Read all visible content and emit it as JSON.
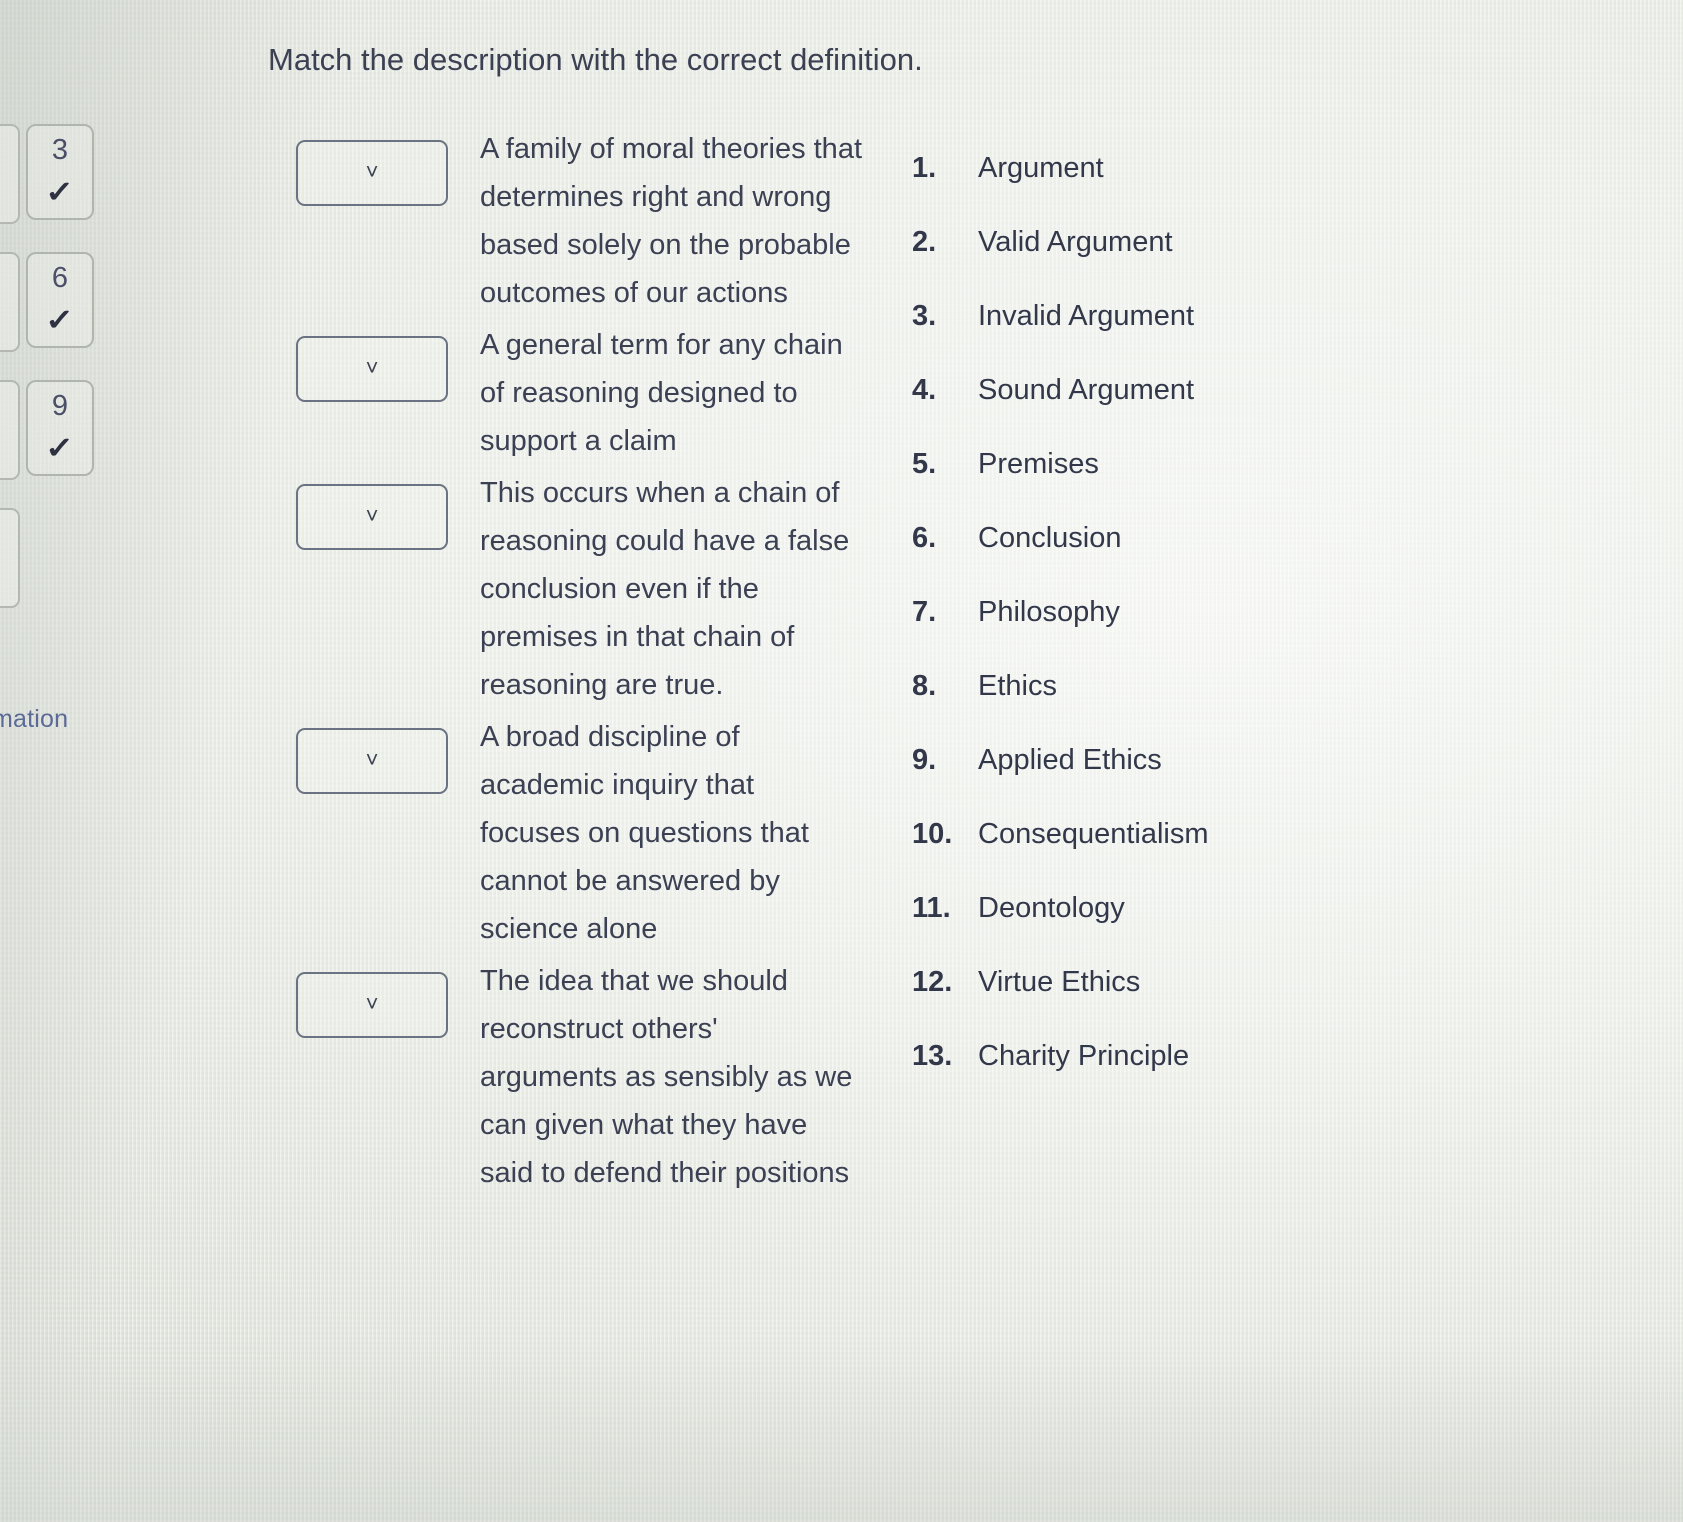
{
  "prompt": "Match the description with the correct definition.",
  "sidebar": {
    "partial_label": "mation",
    "check_glyph": "✓",
    "cards": [
      {
        "number": "3",
        "status": "answered"
      },
      {
        "number": "6",
        "status": "answered"
      },
      {
        "number": "9",
        "status": "answered"
      }
    ]
  },
  "match_rows": [
    {
      "dropdown_value": "",
      "dropdown_icon": "chevron-down-icon",
      "chevron": "˅",
      "description": "A family of moral theories that determines right and wrong based solely on the probable outcomes of our actions"
    },
    {
      "dropdown_value": "",
      "dropdown_icon": "chevron-down-icon",
      "chevron": "˅",
      "description": "A general term for any chain of reasoning designed to support a claim"
    },
    {
      "dropdown_value": "",
      "dropdown_icon": "chevron-down-icon",
      "chevron": "˅",
      "description": "This occurs when a chain of reasoning could have a false conclusion even if the premises in that chain of reasoning are true."
    },
    {
      "dropdown_value": "",
      "dropdown_icon": "chevron-down-icon",
      "chevron": "˅",
      "description": "A broad discipline of academic inquiry that focuses on questions that cannot be answered by science alone"
    },
    {
      "dropdown_value": "",
      "dropdown_icon": "chevron-down-icon",
      "chevron": "˅",
      "description": "The idea that we should reconstruct others' arguments as sensibly as we can given what they have said to defend their positions"
    }
  ],
  "options": [
    {
      "number": "1.",
      "label": "Argument"
    },
    {
      "number": "2.",
      "label": "Valid Argument"
    },
    {
      "number": "3.",
      "label": "Invalid Argument"
    },
    {
      "number": "4.",
      "label": "Sound Argument"
    },
    {
      "number": "5.",
      "label": "Premises"
    },
    {
      "number": "6.",
      "label": "Conclusion"
    },
    {
      "number": "7.",
      "label": "Philosophy"
    },
    {
      "number": "8.",
      "label": "Ethics"
    },
    {
      "number": "9.",
      "label": "Applied Ethics"
    },
    {
      "number": "10.",
      "label": "Consequentialism"
    },
    {
      "number": "11.",
      "label": "Deontology"
    },
    {
      "number": "12.",
      "label": "Virtue Ethics"
    },
    {
      "number": "13.",
      "label": "Charity Principle"
    }
  ],
  "colors": {
    "text": "#3b4053",
    "option_text": "#32384a",
    "nav_number": "#4b4f68",
    "side_word": "#5c6a98",
    "border": "#6b7382",
    "background": "#e3e6e0"
  }
}
